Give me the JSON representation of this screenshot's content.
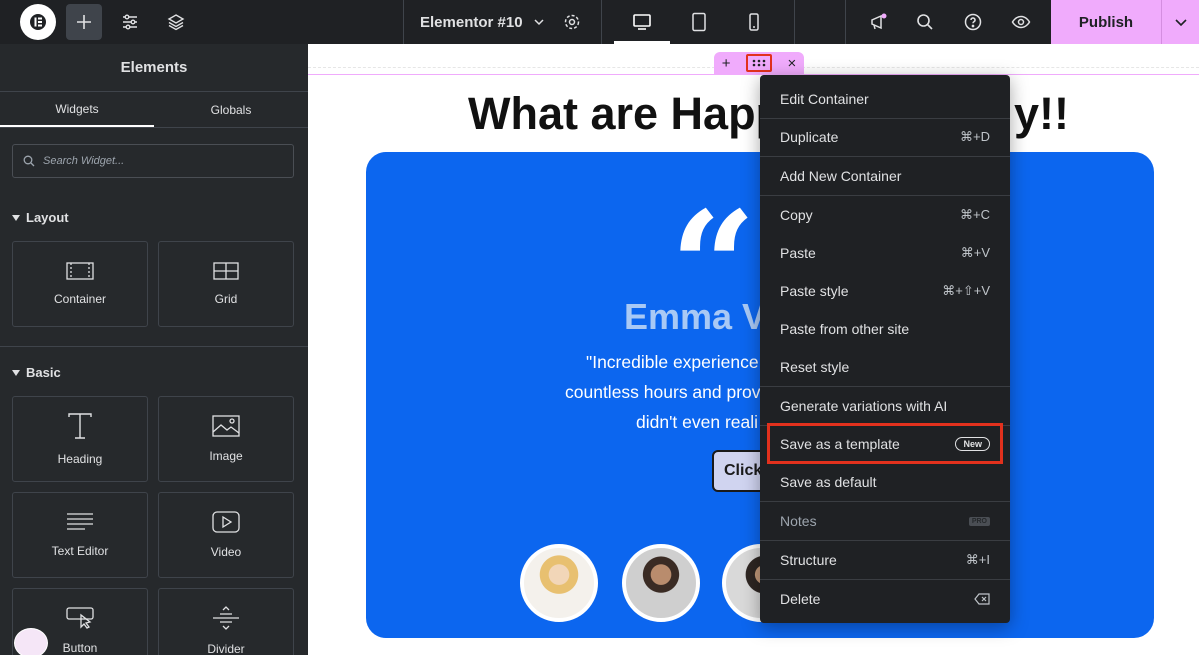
{
  "topbar": {
    "document_title": "Elementor #10",
    "publish_label": "Publish"
  },
  "sidebar": {
    "title": "Elements",
    "tabs": [
      {
        "label": "Widgets"
      },
      {
        "label": "Globals"
      }
    ],
    "search_placeholder": "Search Widget...",
    "sections": [
      {
        "title": "Layout",
        "widgets": [
          {
            "label": "Container"
          },
          {
            "label": "Grid"
          }
        ]
      },
      {
        "title": "Basic",
        "widgets": [
          {
            "label": "Heading"
          },
          {
            "label": "Image"
          },
          {
            "label": "Text Editor"
          },
          {
            "label": "Video"
          },
          {
            "label": "Button"
          },
          {
            "label": "Divider"
          }
        ]
      }
    ]
  },
  "canvas": {
    "heading": "What are Happ",
    "heading_tail": "y!!",
    "testimonial": {
      "name": "Emma V",
      "quote_line1": "\"Incredible experience",
      "quote_line2": "countless hours and prov",
      "quote_line3": "didn't even reali",
      "button_label": "Click"
    }
  },
  "context_menu": {
    "items": [
      {
        "label": "Edit Container",
        "shortcut": ""
      },
      {
        "label": "Duplicate",
        "shortcut": "⌘+D"
      },
      {
        "label": "Add New Container",
        "shortcut": ""
      },
      {
        "label": "Copy",
        "shortcut": "⌘+C"
      },
      {
        "label": "Paste",
        "shortcut": "⌘+V"
      },
      {
        "label": "Paste style",
        "shortcut": "⌘+⇧+V"
      },
      {
        "label": "Paste from other site",
        "shortcut": ""
      },
      {
        "label": "Reset style",
        "shortcut": ""
      },
      {
        "label": "Generate variations with AI",
        "shortcut": ""
      },
      {
        "label": "Save as a template",
        "badge": "New"
      },
      {
        "label": "Save as default",
        "shortcut": ""
      },
      {
        "label": "Notes",
        "badge": "PRO"
      },
      {
        "label": "Structure",
        "shortcut": "⌘+I"
      },
      {
        "label": "Delete",
        "shortcut": ""
      }
    ]
  },
  "colors": {
    "accent_pink": "#f0abfc",
    "card_blue": "#0c66ef",
    "highlight_red": "#e2311d",
    "panel_dark": "#26292c"
  }
}
